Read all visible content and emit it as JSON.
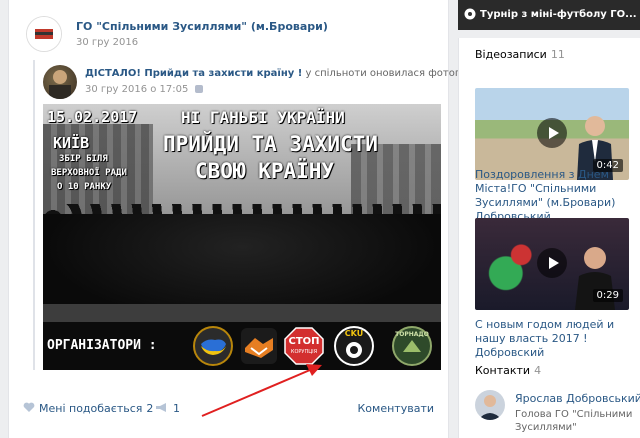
{
  "post": {
    "author": "ГО \"Спільними Зусиллями\" (м.Бровари)",
    "date": "30 гру 2016",
    "repost": {
      "title_bold": "ДІСТАЛО! Прийди та захисти країну !",
      "title_rest": "у спільноти оновилася фотографія",
      "date": "30 гру 2016 о 17:05"
    },
    "poster": {
      "date": "15.02.2017",
      "slogan_line1": "НІ ГАНЬБІ УКРАЇНИ",
      "slogan_line2": "ПРИЙДИ ТА ЗАХИСТИ",
      "slogan_line3": "СВОЮ КРАЇНУ",
      "city": "КИЇВ",
      "place_line1": "ЗБІР БІЛЯ",
      "place_line2": "ВЕРХОВНОЇ РАДИ",
      "place_line3": "О 10 РАНКУ",
      "organizers_label": "ОРГАНІЗАТОРИ :",
      "logo_stop_line1": "СТОП",
      "logo_stop_line2": "КОРУПЦІЯ",
      "logo_cku": "CKU",
      "logo_tornado": "ТОРНАДО"
    },
    "actions": {
      "like_label": "Мені подобається",
      "like_count": "2",
      "share_count": "1",
      "comment_label": "Коментувати"
    }
  },
  "sidebar": {
    "top_banner": "Турнір з міні-футболу ГО...",
    "videos_title": "Відеозаписи",
    "videos_count": "11",
    "videos": [
      {
        "duration": "0:42",
        "title": "Поздоровлення з Днем Міста!ГО \"Спільними Зусиллями\" (м.Бровари) Добровський"
      },
      {
        "duration": "0:29",
        "title": "С новым годом людей и нашу власть 2017 ! Добровский"
      }
    ],
    "contacts_title": "Контакти",
    "contacts_count": "4",
    "contact": {
      "name": "Ярослав Добровський",
      "role": "Голова ГО \"Спільними Зусиллями\""
    }
  },
  "colors": {
    "link": "#2a5885",
    "muted": "#939393",
    "background": "#edeef0",
    "arrow": "#e02020"
  }
}
